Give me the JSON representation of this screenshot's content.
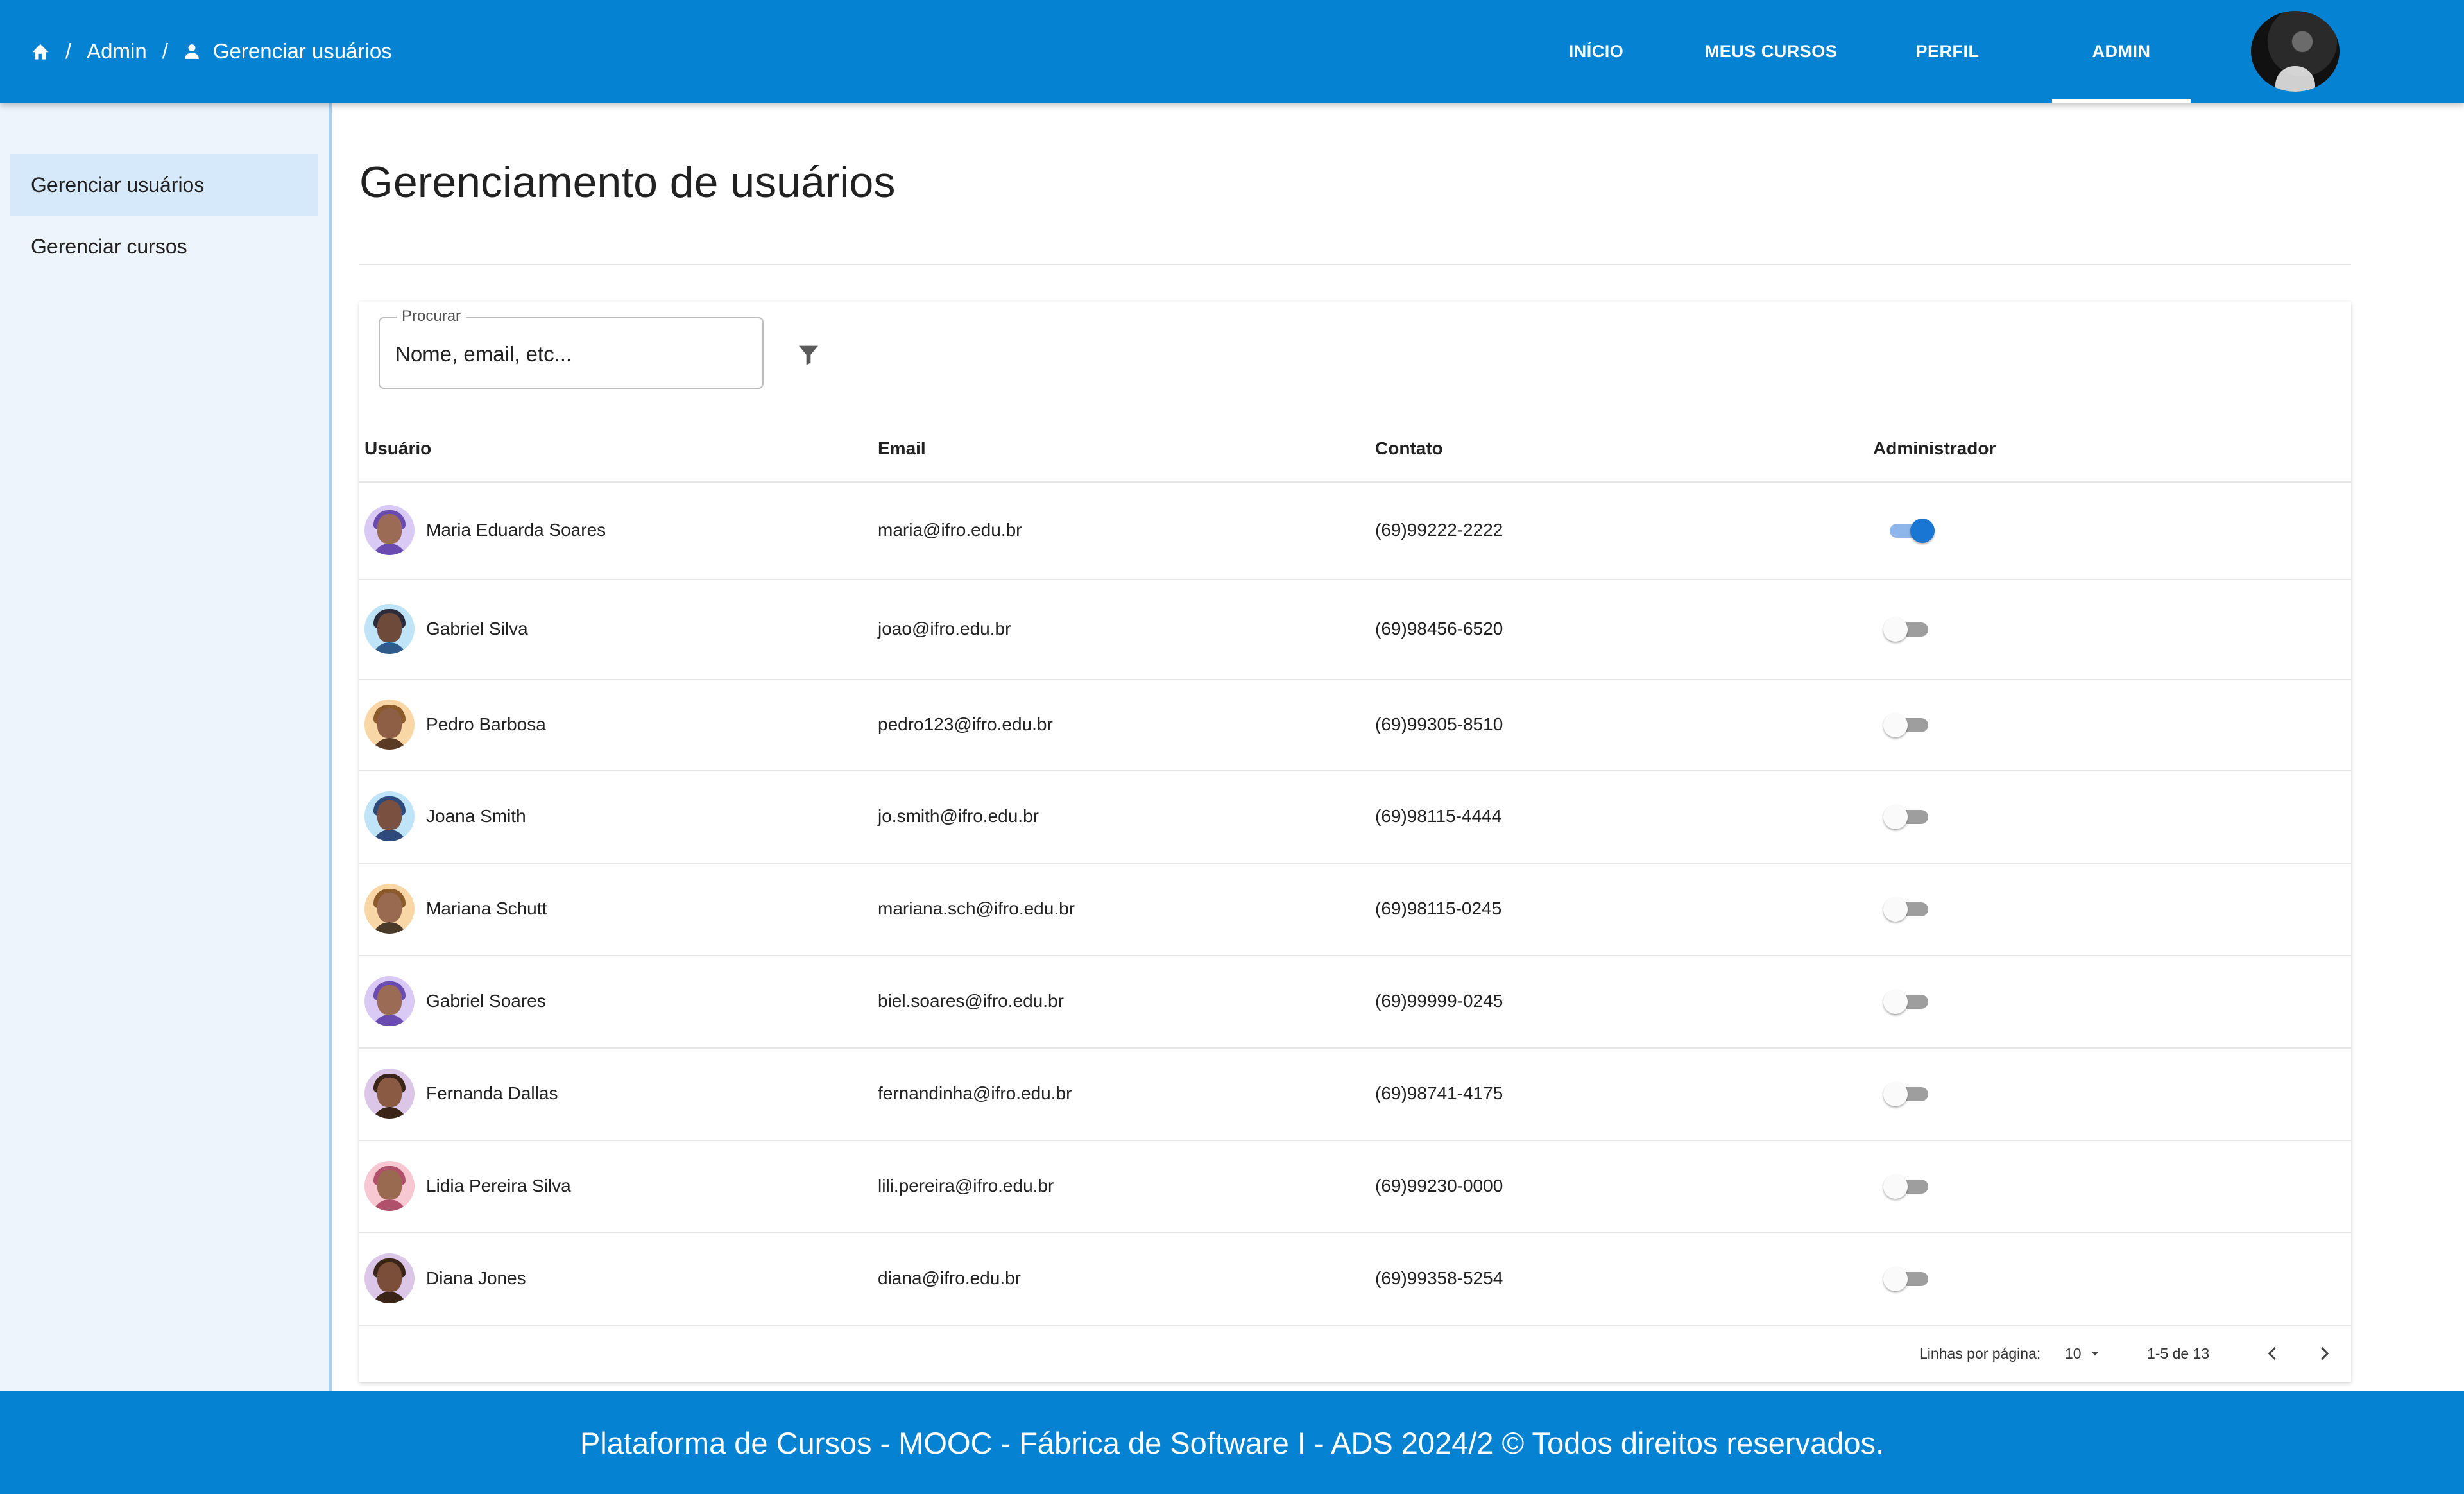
{
  "breadcrumb": {
    "home_icon": "home-icon",
    "admin": "Admin",
    "separator": "/",
    "user_icon": "person-icon",
    "current": "Gerenciar usuários"
  },
  "nav": {
    "items": [
      "INÍCIO",
      "MEUS CURSOS",
      "PERFIL",
      "ADMIN"
    ],
    "active": "ADMIN"
  },
  "sidebar": {
    "items": [
      {
        "label": "Gerenciar usuários",
        "active": true
      },
      {
        "label": "Gerenciar cursos",
        "active": false
      }
    ]
  },
  "main": {
    "title": "Gerenciamento de usuários"
  },
  "search": {
    "label": "Procurar",
    "placeholder": "Nome, email, etc...",
    "filter_icon": "filter-icon"
  },
  "table": {
    "columns": [
      "Usuário",
      "Email",
      "Contato",
      "Administrador"
    ],
    "rows": [
      {
        "name": "Maria Eduarda Soares",
        "email": "maria@ifro.edu.br",
        "contact": "(69)99222-2222",
        "admin": true
      },
      {
        "name": "Gabriel Silva",
        "email": "joao@ifro.edu.br",
        "contact": "(69)98456-6520",
        "admin": false
      },
      {
        "name": "Pedro Barbosa",
        "email": "pedro123@ifro.edu.br",
        "contact": "(69)99305-8510",
        "admin": false
      },
      {
        "name": "Joana Smith",
        "email": "jo.smith@ifro.edu.br",
        "contact": "(69)98115-4444",
        "admin": false
      },
      {
        "name": "Mariana Schutt",
        "email": "mariana.sch@ifro.edu.br",
        "contact": "(69)98115-0245",
        "admin": false
      },
      {
        "name": "Gabriel Soares",
        "email": "biel.soares@ifro.edu.br",
        "contact": "(69)99999-0245",
        "admin": false
      },
      {
        "name": "Fernanda Dallas",
        "email": "fernandinha@ifro.edu.br",
        "contact": "(69)98741-4175",
        "admin": false
      },
      {
        "name": "Lidia Pereira Silva",
        "email": "lili.pereira@ifro.edu.br",
        "contact": "(69)99230-0000",
        "admin": false
      },
      {
        "name": "Diana Jones",
        "email": "diana@ifro.edu.br",
        "contact": "(69)99358-5254",
        "admin": false
      }
    ]
  },
  "pagination": {
    "rows_per_page_label": "Linhas por página:",
    "rows_per_page": "10",
    "range": "1-5 de 13"
  },
  "footer": {
    "text": "Plataforma de Cursos - MOOC - Fábrica de Software I - ADS 2024/2  ©  Todos direitos reservados."
  },
  "colors": {
    "primary": "#0583d2",
    "sidebar_bg": "#edf4fc",
    "sidebar_active": "#d6e9fa",
    "toggle_on": "#1976d2"
  }
}
